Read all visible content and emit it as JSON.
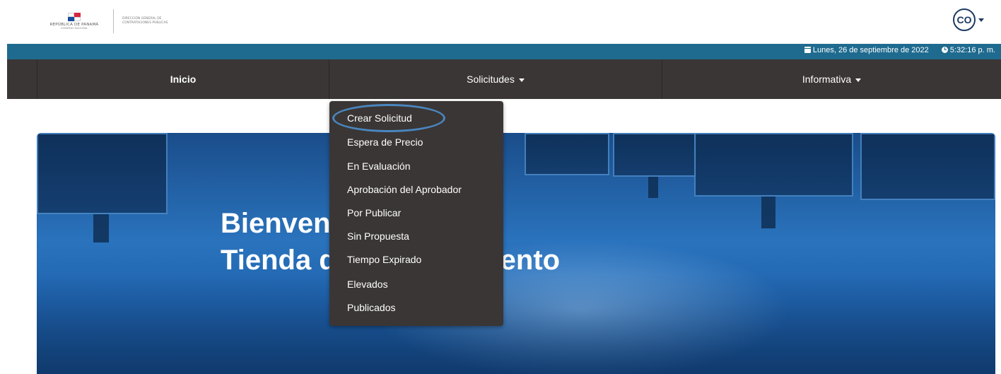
{
  "header": {
    "logo": {
      "country": "REPÚBLICA DE PANAMÁ",
      "government": "GOBIERNO NACIONAL",
      "agency_line1": "DIRECCIÓN GENERAL DE",
      "agency_line2": "CONTRATACIONES PÚBLICAS"
    },
    "user": {
      "initials": "CO"
    }
  },
  "infobar": {
    "date": "Lunes, 26 de septiembre de 2022",
    "time": "5:32:16 p. m."
  },
  "nav": {
    "items": [
      {
        "label": "Inicio"
      },
      {
        "label": "Solicitudes"
      },
      {
        "label": "Informativa"
      }
    ]
  },
  "dropdown": {
    "items": [
      {
        "label": "Crear Solicitud"
      },
      {
        "label": "Espera de Precio"
      },
      {
        "label": "En Evaluación"
      },
      {
        "label": "Aprobación del Aprobador"
      },
      {
        "label": "Por Publicar"
      },
      {
        "label": "Sin Propuesta"
      },
      {
        "label": "Tiempo Expirado"
      },
      {
        "label": "Elevados"
      },
      {
        "label": "Publicados"
      }
    ]
  },
  "hero": {
    "title_line1": "Bienvenido a la",
    "title_line2": "Tienda de Arrendamiento"
  }
}
